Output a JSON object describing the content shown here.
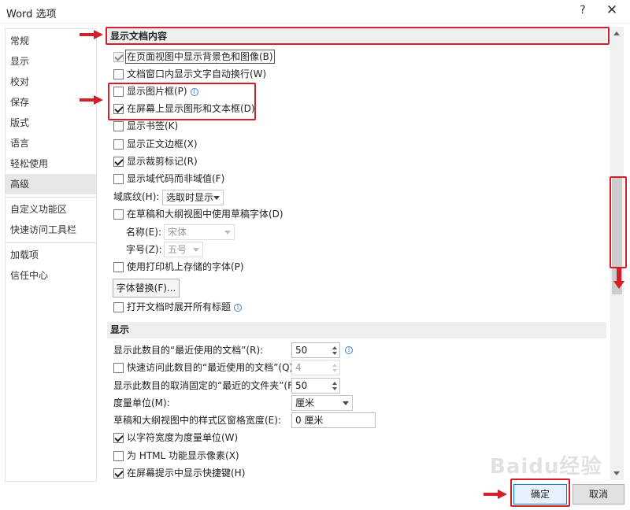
{
  "window": {
    "title": "Word 选项",
    "help": "?",
    "close": "✕"
  },
  "sidebar": {
    "items": [
      {
        "label": "常规"
      },
      {
        "label": "显示"
      },
      {
        "label": "校对"
      },
      {
        "label": "保存"
      },
      {
        "label": "版式"
      },
      {
        "label": "语言"
      },
      {
        "label": "轻松使用"
      },
      {
        "label": "高级",
        "active": true
      },
      {
        "label": "自定义功能区"
      },
      {
        "label": "快速访问工具栏"
      },
      {
        "label": "加载项"
      },
      {
        "label": "信任中心"
      }
    ]
  },
  "show_doc": {
    "header": "显示文档内容",
    "bg_colors": {
      "label": "在页面视图中显示背景色和图像(B)",
      "checked": true,
      "disabled": true
    },
    "wrap": {
      "label": "文档窗口内显示文字自动换行(W)",
      "checked": false
    },
    "placeholders": {
      "label": "显示图片框(P)",
      "checked": false
    },
    "drawings": {
      "label": "在屏幕上显示图形和文本框(D)",
      "checked": true
    },
    "bookmarks": {
      "label": "显示书签(K)",
      "checked": false
    },
    "text_bounds": {
      "label": "显示正文边框(X)",
      "checked": false
    },
    "crop_marks": {
      "label": "显示裁剪标记(R)",
      "checked": true
    },
    "field_codes": {
      "label": "显示域代码而非域值(F)",
      "checked": false
    },
    "field_shading": {
      "label": "域底纹(H):",
      "value": "选取时显示"
    },
    "draft_font": {
      "label": "在草稿和大纲视图中使用草稿字体(D)",
      "checked": false
    },
    "font_name": {
      "label": "名称(E):",
      "value": "宋体"
    },
    "font_size": {
      "label": "字号(Z):",
      "value": "五号"
    },
    "printer_fonts": {
      "label": "使用打印机上存储的字体(P)",
      "checked": false
    },
    "font_subst": {
      "label": "字体替换(F)..."
    },
    "expand_headings": {
      "label": "打开文档时展开所有标题",
      "checked": false
    }
  },
  "display": {
    "header": "显示",
    "recent_docs": {
      "label": "显示此数目的“最近使用的文档”(R):",
      "value": "50"
    },
    "quick_recent": {
      "label": "快速访问此数目的“最近使用的文档”(Q):",
      "checked": false,
      "value": "4"
    },
    "recent_folders": {
      "label": "显示此数目的取消固定的“最近的文件夹”(F):",
      "value": "50"
    },
    "units": {
      "label": "度量单位(M):",
      "value": "厘米"
    },
    "style_width": {
      "label": "草稿和大纲视图中的样式区窗格宽度(E):",
      "value": "0 厘米"
    },
    "char_width": {
      "label": "以字符宽度为度量单位(W)",
      "checked": true
    },
    "html_pixels": {
      "label": "为 HTML 功能显示像素(X)",
      "checked": false
    },
    "shortcut_keys": {
      "label": "在屏幕提示中显示快捷键(H)",
      "checked": true
    }
  },
  "footer": {
    "ok": "确定",
    "cancel": "取消"
  },
  "watermark": "Baidu经验",
  "colors": {
    "annotation_red": "#d2202a",
    "active_side": "#e6e6e6",
    "section_bg": "#efefef"
  }
}
